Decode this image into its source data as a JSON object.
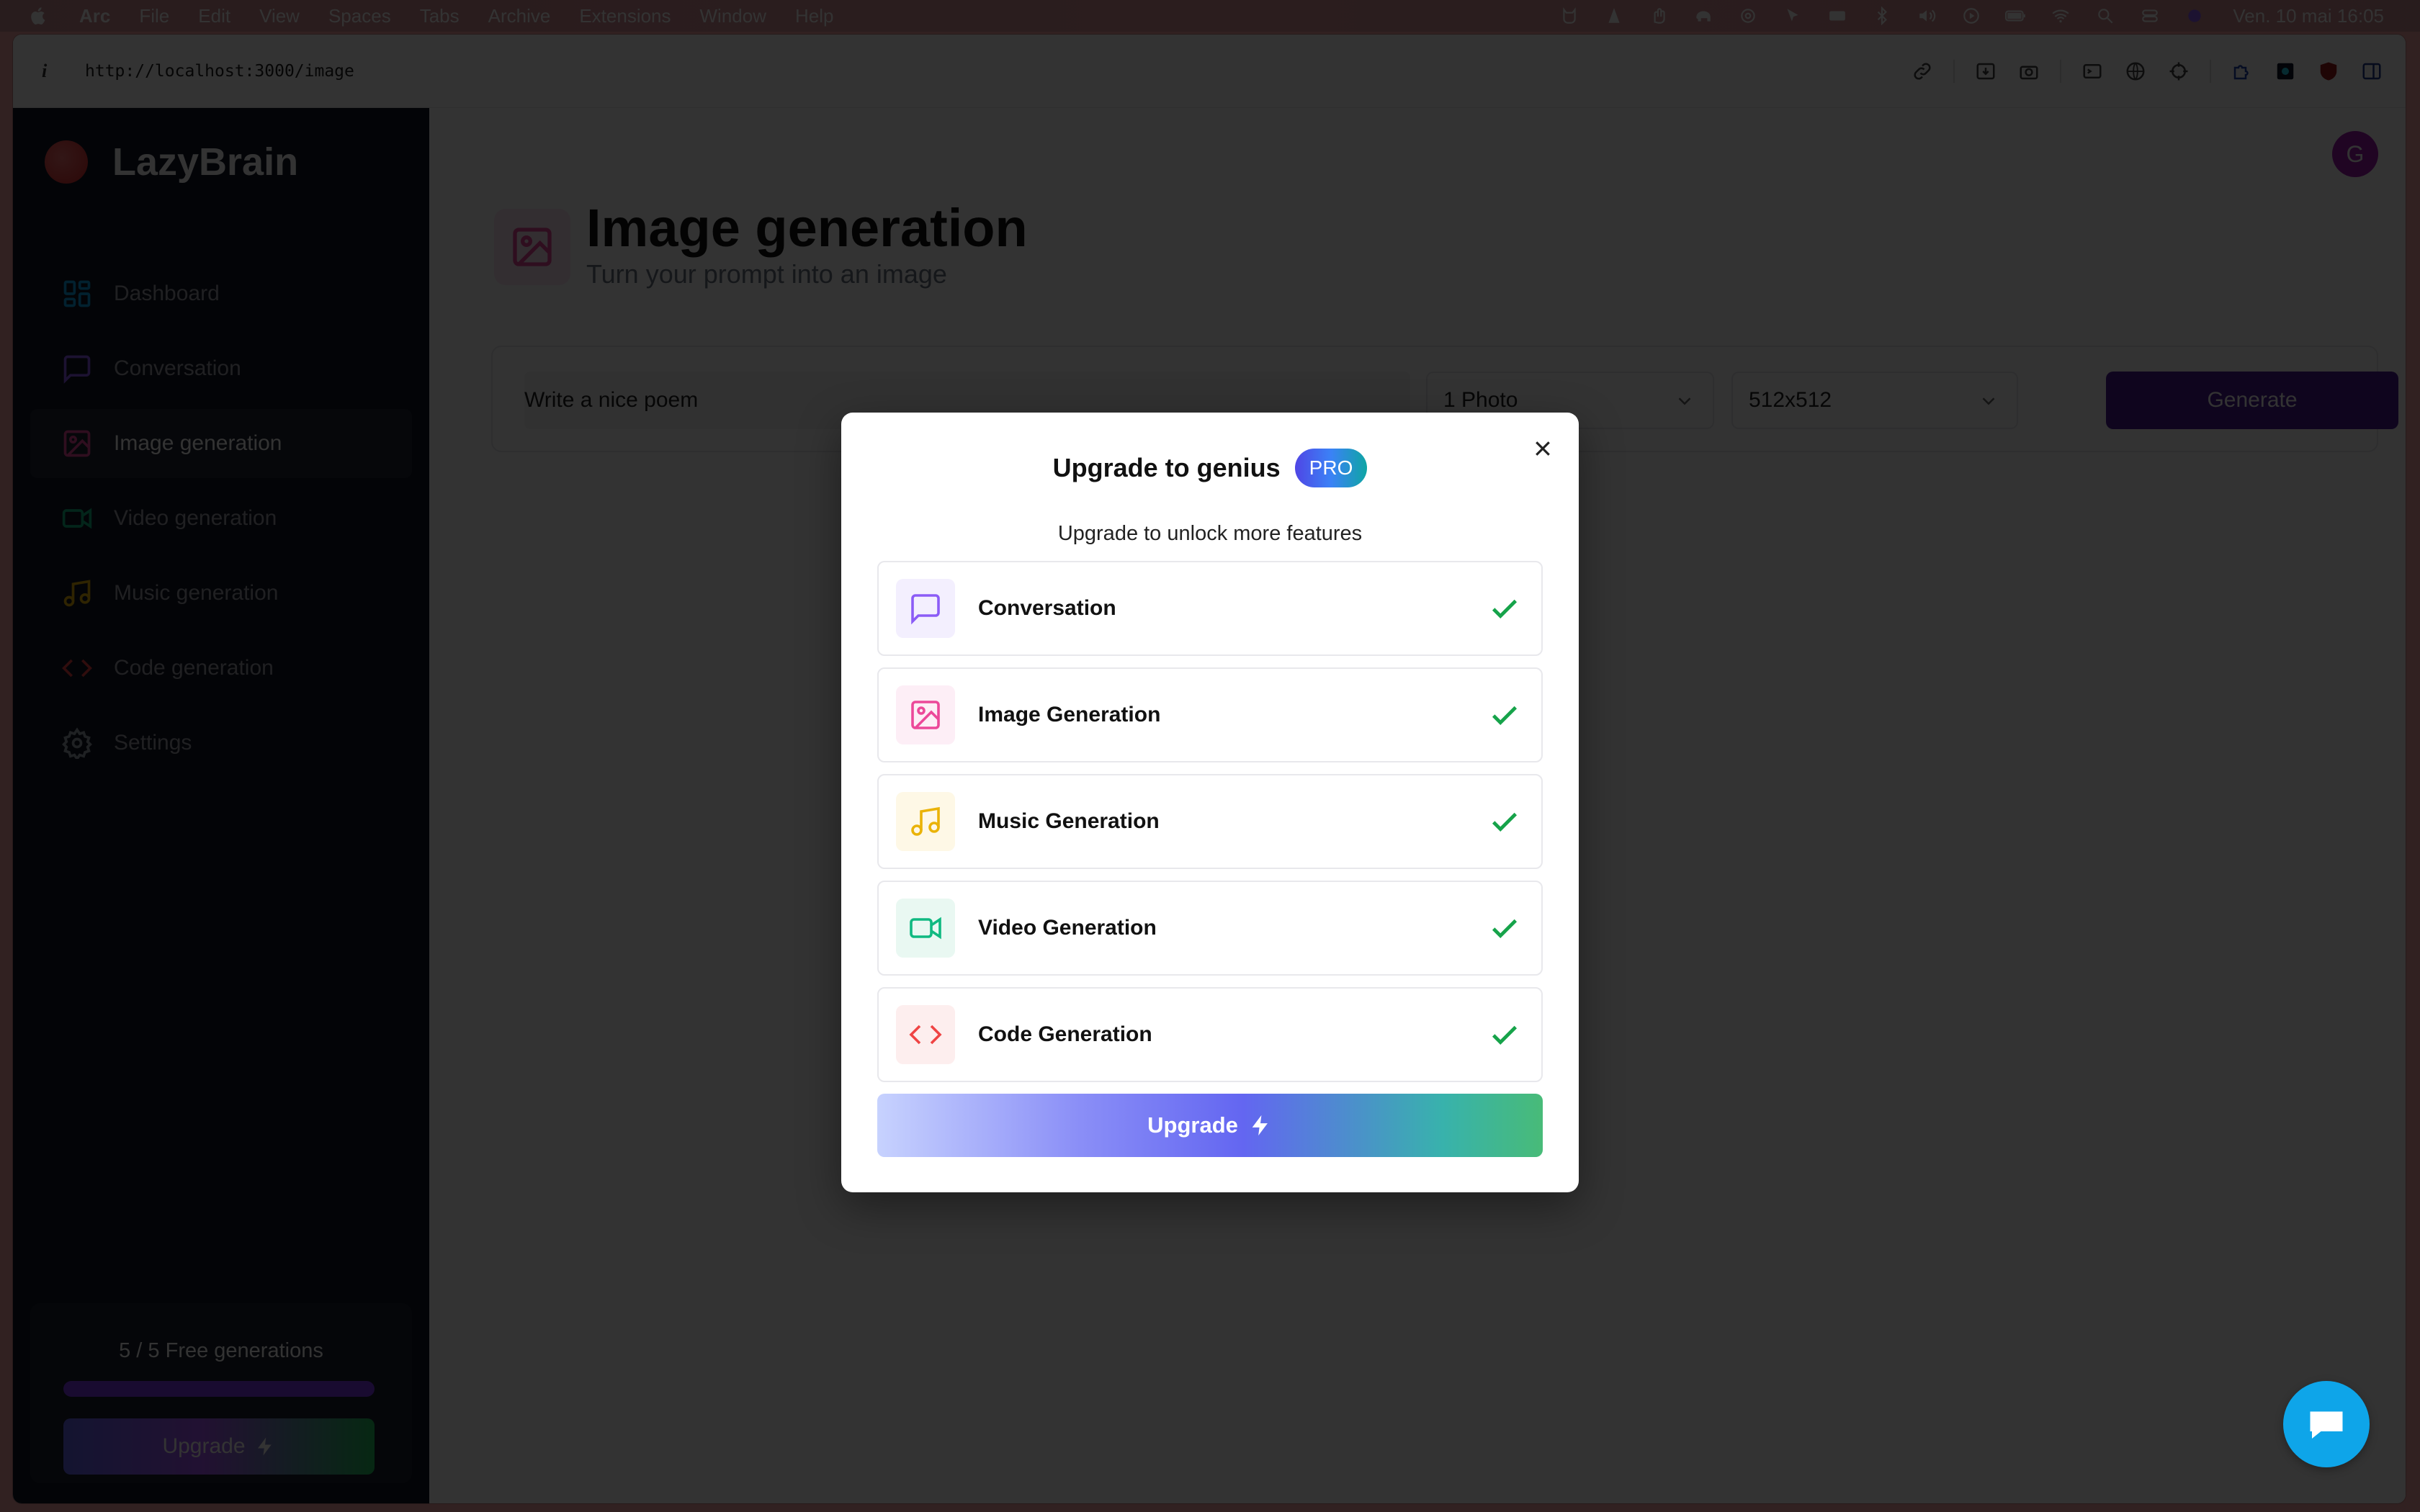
{
  "menubar": {
    "items": [
      "Arc",
      "File",
      "Edit",
      "View",
      "Spaces",
      "Tabs",
      "Archive",
      "Extensions",
      "Window",
      "Help"
    ],
    "clock": "Ven. 10 mai  16:05"
  },
  "browser": {
    "url": "http://localhost:3000/image",
    "info_glyph": "i"
  },
  "sidebar": {
    "app_name": "LazyBrain",
    "items": [
      {
        "label": "Dashboard",
        "icon": "dashboard-icon",
        "color": "#0ea5e9"
      },
      {
        "label": "Conversation",
        "icon": "message-icon",
        "color": "#8b5cf6"
      },
      {
        "label": "Image generation",
        "icon": "image-icon",
        "color": "#ec4899"
      },
      {
        "label": "Video generation",
        "icon": "video-icon",
        "color": "#10b981"
      },
      {
        "label": "Music generation",
        "icon": "music-icon",
        "color": "#eab308"
      },
      {
        "label": "Code generation",
        "icon": "code-icon",
        "color": "#ef4444"
      },
      {
        "label": "Settings",
        "icon": "settings-icon",
        "color": "#9ca3af"
      }
    ],
    "free_count": "5 / 5 Free generations",
    "free_progress": 1.0,
    "upgrade_label": "Upgrade"
  },
  "header": {
    "avatar_letter": "G",
    "title": "Image generation",
    "subtitle": "Turn your prompt into an image"
  },
  "form": {
    "prompt_value": "Write a nice poem",
    "amount": "1 Photo",
    "resolution": "512x512",
    "generate_label": "Generate"
  },
  "modal": {
    "title": "Upgrade to genius",
    "badge": "PRO",
    "subtitle": "Upgrade to unlock more features",
    "features": [
      {
        "label": "Conversation",
        "icon": "message-icon",
        "color": "#8b5cf6",
        "bg": "#f3effe"
      },
      {
        "label": "Image Generation",
        "icon": "image-icon",
        "color": "#ec4899",
        "bg": "#fdeef6"
      },
      {
        "label": "Music Generation",
        "icon": "music-icon",
        "color": "#eab308",
        "bg": "#fef8e6"
      },
      {
        "label": "Video Generation",
        "icon": "video-icon",
        "color": "#10b981",
        "bg": "#e9f8f2"
      },
      {
        "label": "Code Generation",
        "icon": "code-icon",
        "color": "#ef4444",
        "bg": "#fdeeee"
      }
    ],
    "upgrade_label": "Upgrade"
  }
}
